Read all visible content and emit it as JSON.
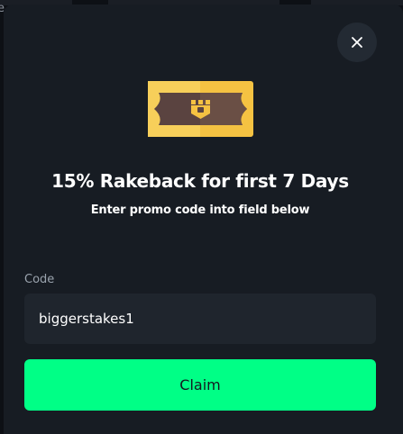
{
  "background": {
    "partial_text": "e"
  },
  "modal": {
    "title": "15% Rakeback for first 7 Days",
    "subtitle": "Enter promo code into field below",
    "close_icon": "close-icon",
    "ticket_icon": "ticket-icon",
    "code": {
      "label": "Code",
      "value": "biggerstakes1"
    },
    "claim_label": "Claim"
  },
  "colors": {
    "modal_bg": "#171c23",
    "input_bg": "#1f252d",
    "accent_green": "#00ff86",
    "ticket_gold": "#f5c242",
    "ticket_brown": "#5a4340"
  }
}
